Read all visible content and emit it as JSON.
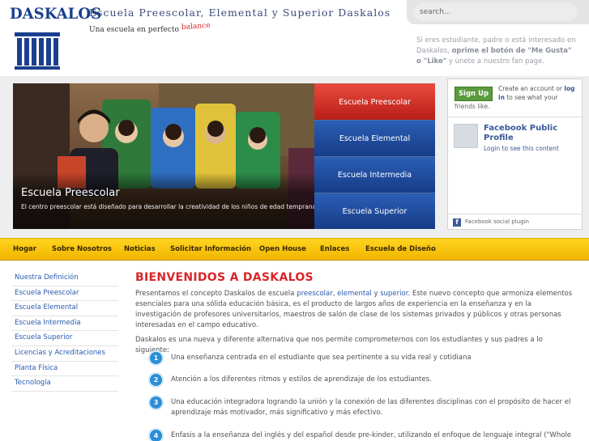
{
  "header": {
    "logo_text": "DASKALOS",
    "site_title": "Escuela Preescolar, Elemental y Superior Daskalos",
    "tagline": "Una escuela en perfecto",
    "tagline_accent": "balance"
  },
  "search": {
    "placeholder": "search..."
  },
  "fan_note": {
    "part1": "Si eres estudiante, padre o está interesado en Daskalos,",
    "bold": "oprime el botón de \"Me Gusta\" o \"Like\"",
    "part2": "y únete a nuestro fan page."
  },
  "hero": {
    "title": "Escuela Preescolar",
    "caption": "El centro preescolar está diseñado para desarrollar la creatividad de los niños de edad temprana."
  },
  "school_menu": [
    {
      "label": "Escuela Preescolar",
      "active": true
    },
    {
      "label": "Escuela Elemental",
      "active": false
    },
    {
      "label": "Escuela Intermedia",
      "active": false
    },
    {
      "label": "Escuela Superior",
      "active": false
    }
  ],
  "facebook": {
    "signup_label": "Sign Up",
    "signup_text_pre": "Create an account or",
    "signup_link": "log in",
    "signup_text_post": "to see what your",
    "friends_text": "friends like.",
    "profile_name": "Facebook Public Profile",
    "login_text": "Login to see this content",
    "footer_text": "Facebook social plugin"
  },
  "nav": [
    {
      "label": "Hogar"
    },
    {
      "label": "Sobre Nosotros"
    },
    {
      "label": "Noticias"
    },
    {
      "label": "Solicitar Información"
    },
    {
      "label": "Open House"
    },
    {
      "label": "Enlaces"
    },
    {
      "label": "Escuela de Diseño"
    }
  ],
  "sidebar": [
    {
      "label": "Nuestra Definición"
    },
    {
      "label": "Escuela Preescolar"
    },
    {
      "label": "Escuela Elemental"
    },
    {
      "label": "Escuela Intermedia"
    },
    {
      "label": "Escuela Superior"
    },
    {
      "label": "Licencias y Acreditaciones"
    },
    {
      "label": "Planta Física"
    },
    {
      "label": "Tecnología"
    }
  ],
  "content": {
    "title": "BIENVENIDOS A DASKALOS",
    "intro_pre": "Presentamos el concepto Daskalos de escuela",
    "intro_link1": "preescolar",
    "intro_link2": "elemental",
    "intro_and": "y",
    "intro_link3": "superior",
    "intro_post": ". Este nuevo concepto que armoniza elementos esenciales para una sólida educación básica, es el producto de largos años de experiencia en la enseñanza y en la investigación de profesores universitarios, maestros de salón de clase de los sistemas privados y públicos y otras personas interesadas en el campo educativo.",
    "intro2": "Daskalos es una nueva y diferente alternativa que nos permite comprometernos con los estudiantes y sus padres a lo siguiente:",
    "points": [
      {
        "num": "1",
        "text": "Una enseñanza centrada en el estudiante que sea pertinente a su vida real y cotidiana"
      },
      {
        "num": "2",
        "text": "Atención a los diferentes ritmos y estilos de aprendizaje de los estudiantes."
      },
      {
        "num": "3",
        "text": "Una educación integradora logrando la unión y la conexión de las diferentes disciplinas con el propósito de hacer el aprendizaje más motivador, más significativo y más efectivo."
      },
      {
        "num": "4",
        "text": "Enfasis a la enseñanza del inglés y del español desde pre-kinder, utilizando el enfoque de lenguaje integral (\"Whole"
      }
    ]
  },
  "colors": {
    "accent_red": "#d8262a",
    "brand_blue": "#1b3f8f",
    "link_blue": "#2a5bb0",
    "nav_yellow": "#f7c612"
  }
}
